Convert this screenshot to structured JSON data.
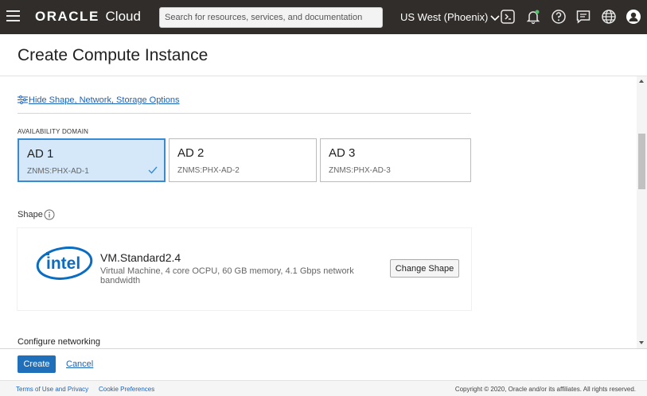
{
  "topbar": {
    "logo_brand": "ORACLE",
    "logo_product": "Cloud",
    "search_placeholder": "Search for resources, services, and documentation",
    "region": "US West (Phoenix)",
    "icons": [
      "menu-icon",
      "cloud-shell-icon",
      "notifications-icon",
      "help-icon",
      "feedback-icon",
      "language-icon",
      "user-icon"
    ]
  },
  "page": {
    "title": "Create Compute Instance"
  },
  "options_link": "Hide Shape, Network, Storage Options",
  "availability": {
    "label": "AVAILABILITY DOMAIN",
    "domains": [
      {
        "name": "AD 1",
        "sub": "ZNMS:PHX-AD-1",
        "selected": true
      },
      {
        "name": "AD 2",
        "sub": "ZNMS:PHX-AD-2",
        "selected": false
      },
      {
        "name": "AD 3",
        "sub": "ZNMS:PHX-AD-3",
        "selected": false
      }
    ]
  },
  "shape": {
    "label": "Shape",
    "vendor": "intel",
    "name": "VM.Standard2.4",
    "description": "Virtual Machine, 4 core OCPU, 60 GB memory, 4.1 Gbps network bandwidth",
    "change_label": "Change Shape"
  },
  "networking": {
    "label": "Configure networking"
  },
  "actions": {
    "create_label": "Create",
    "cancel_label": "Cancel"
  },
  "footer": {
    "terms": "Terms of Use and Privacy",
    "cookies": "Cookie Preferences",
    "copyright": "Copyright © 2020, Oracle and/or its affiliates. All rights reserved."
  },
  "colors": {
    "topbar": "#312d2a",
    "accent": "#1f6fba",
    "selected_bg": "#d4e8fa",
    "link": "#1b63b8"
  }
}
